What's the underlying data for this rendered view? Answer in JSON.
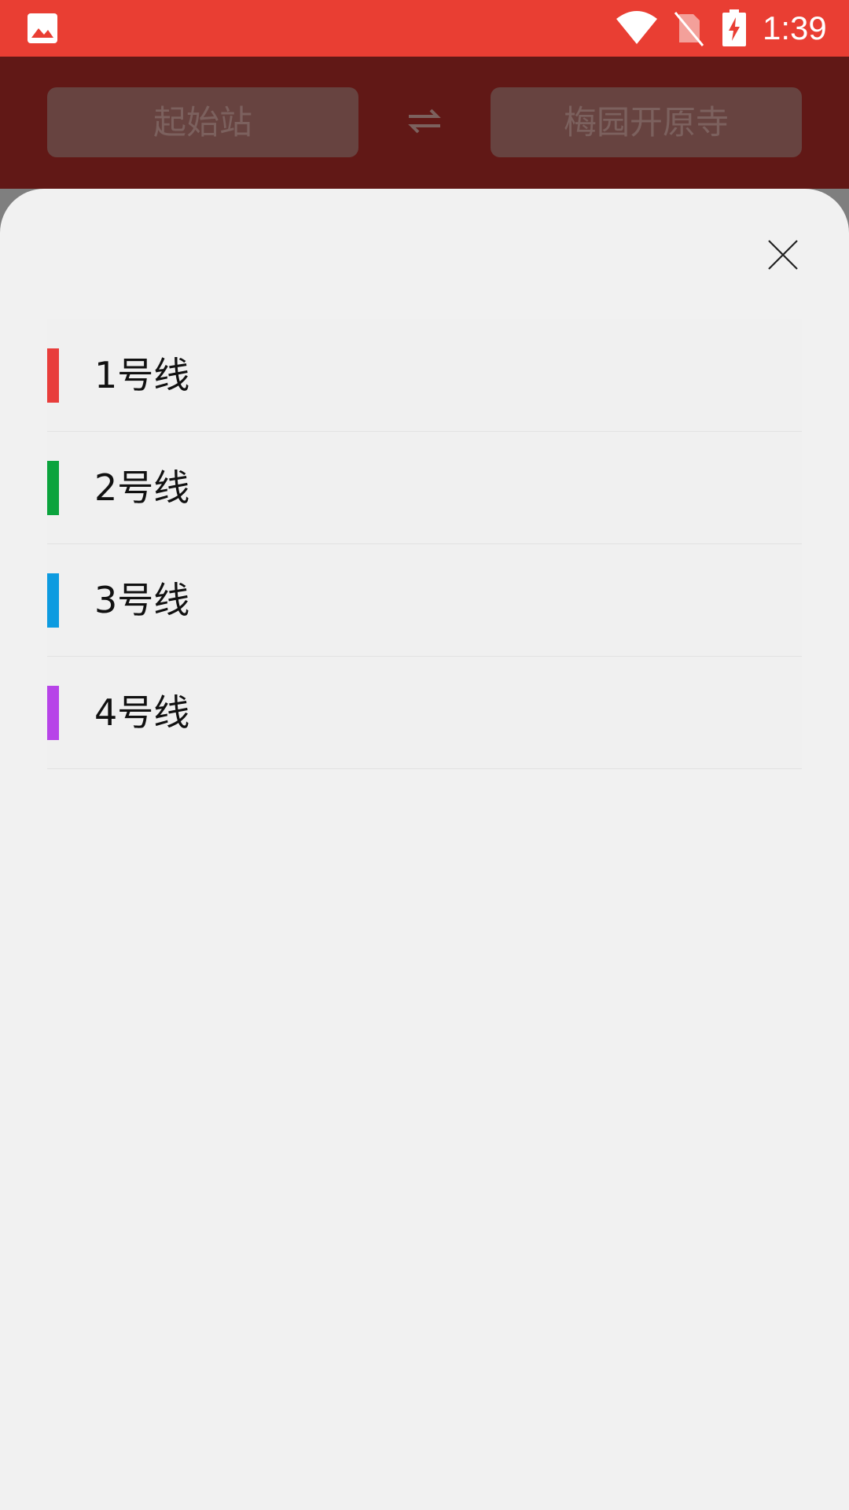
{
  "status_bar": {
    "time": "1:39",
    "icons": [
      "gallery-icon",
      "wifi-icon",
      "no-sim-icon",
      "battery-charging-icon"
    ],
    "color": "#e93e33"
  },
  "header": {
    "start_station": "起始站",
    "end_station": "梅园开原寺",
    "swap_icon": "swap-arrows-icon"
  },
  "sheet": {
    "close_icon": "close-icon",
    "lines": [
      {
        "label": "1号线",
        "color": "#e83d3b"
      },
      {
        "label": "2号线",
        "color": "#0ba33d"
      },
      {
        "label": "3号线",
        "color": "#0d9be0"
      },
      {
        "label": "4号线",
        "color": "#b744e8"
      }
    ]
  }
}
